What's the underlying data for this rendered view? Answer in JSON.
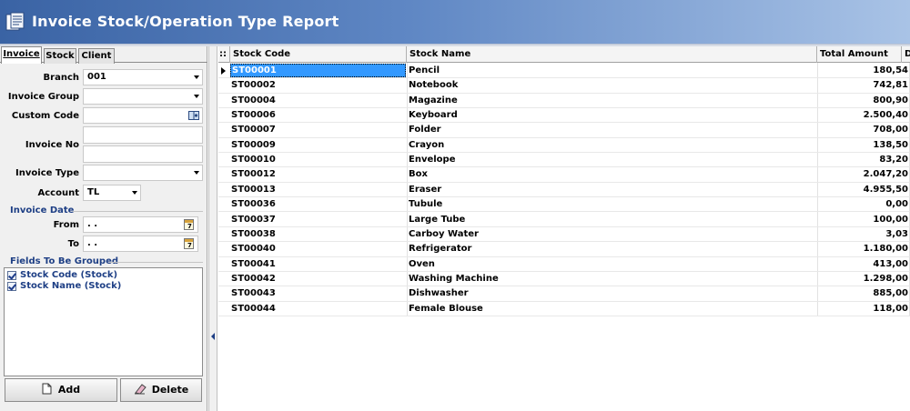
{
  "app": {
    "title": "Invoice Stock/Operation Type Report",
    "icon": "report-icon"
  },
  "tabs": [
    {
      "label": "Invoice",
      "active": true
    },
    {
      "label": "Stock",
      "active": false
    },
    {
      "label": "Client",
      "active": false
    }
  ],
  "filters": {
    "branch": {
      "label": "Branch",
      "value": "001"
    },
    "invoice_group": {
      "label": "Invoice Group",
      "value": ""
    },
    "custom_code": {
      "label": "Custom Code",
      "value": ""
    },
    "invoice_no": {
      "label": "Invoice No",
      "value1": "",
      "value2": ""
    },
    "invoice_type": {
      "label": "Invoice Type",
      "value": ""
    },
    "account": {
      "label": "Account",
      "value": "TL"
    },
    "invoice_date": {
      "title": "Invoice Date",
      "from_label": "From",
      "from_value": ". .",
      "to_label": "To",
      "to_value": ". ."
    }
  },
  "grouping": {
    "title": "Fields To Be Grouped",
    "items": [
      {
        "label": "Stock Code (Stock)",
        "checked": true
      },
      {
        "label": "Stock Name (Stock)",
        "checked": true
      }
    ],
    "add_label": "Add",
    "delete_label": "Delete"
  },
  "grid": {
    "columns": [
      "Stock Code",
      "Stock Name",
      "Total Amount",
      "D"
    ],
    "header_marker": "::",
    "selected_row": 0,
    "rows": [
      {
        "code": "ST00001",
        "name": "Pencil",
        "amount": "180,54"
      },
      {
        "code": "ST00002",
        "name": "Notebook",
        "amount": "742,81"
      },
      {
        "code": "ST00004",
        "name": "Magazine",
        "amount": "800,90"
      },
      {
        "code": "ST00006",
        "name": "Keyboard",
        "amount": "2.500,40"
      },
      {
        "code": "ST00007",
        "name": "Folder",
        "amount": "708,00"
      },
      {
        "code": "ST00009",
        "name": "Crayon",
        "amount": "138,50"
      },
      {
        "code": "ST00010",
        "name": "Envelope",
        "amount": "83,20"
      },
      {
        "code": "ST00012",
        "name": "Box",
        "amount": "2.047,20"
      },
      {
        "code": "ST00013",
        "name": "Eraser",
        "amount": "4.955,50"
      },
      {
        "code": "ST00036",
        "name": "Tubule",
        "amount": "0,00"
      },
      {
        "code": "ST00037",
        "name": "Large Tube",
        "amount": "100,00"
      },
      {
        "code": "ST00038",
        "name": "Carboy Water",
        "amount": "3,03"
      },
      {
        "code": "ST00040",
        "name": "Refrigerator",
        "amount": "1.180,00"
      },
      {
        "code": "ST00041",
        "name": "Oven",
        "amount": "413,00"
      },
      {
        "code": "ST00042",
        "name": "Washing Machine",
        "amount": "1.298,00"
      },
      {
        "code": "ST00043",
        "name": "Dishwasher",
        "amount": "885,00"
      },
      {
        "code": "ST00044",
        "name": "Female Blouse",
        "amount": "118,00"
      }
    ]
  },
  "colors": {
    "titlebar_start": "#3a63a4",
    "titlebar_end": "#a9c3e6",
    "selection": "#3399ff",
    "group_title": "#1e3f85"
  }
}
